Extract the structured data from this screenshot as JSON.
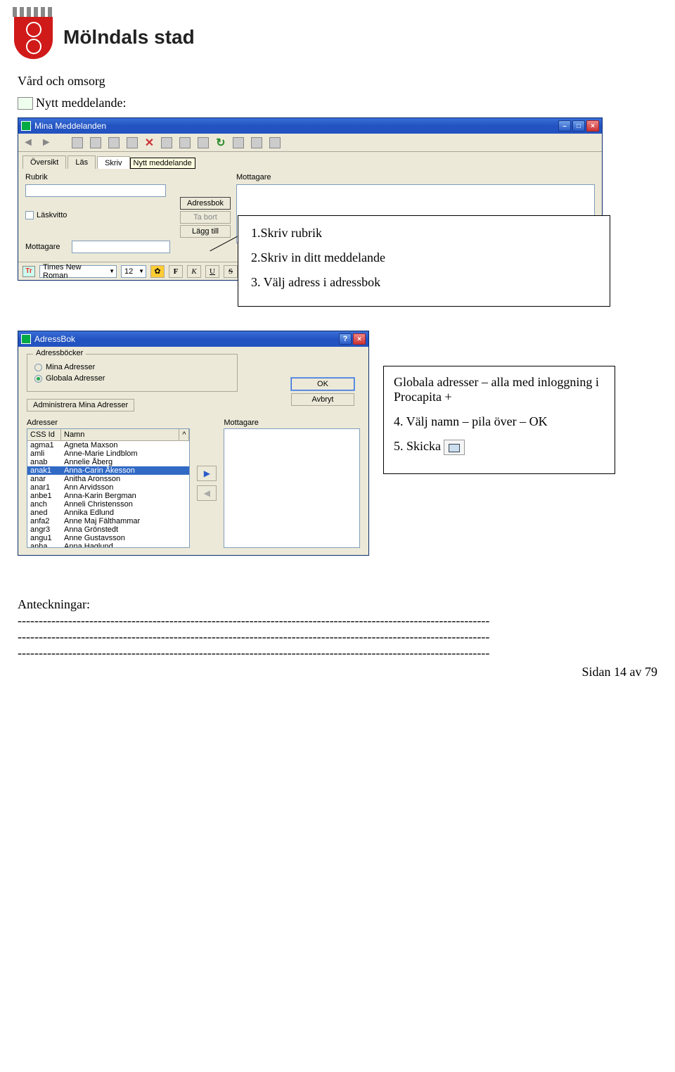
{
  "header": {
    "org": "Mölndals stad"
  },
  "section": {
    "title": "Vård och omsorg",
    "new_msg": "Nytt meddelande:"
  },
  "win_main": {
    "title": "Mina Meddelanden",
    "tabs": {
      "t1": "Översikt",
      "t2": "Läs",
      "t3": "Skriv",
      "tooltip": "Nytt meddelande"
    },
    "labels": {
      "rubrik": "Rubrik",
      "mottagare_top": "Mottagare",
      "laskvitto": "Läskvitto",
      "mottagare": "Mottagare"
    },
    "buttons": {
      "adressbok": "Adressbok",
      "tabort": "Ta bort",
      "laggtill": "Lägg till"
    },
    "format": {
      "font_name": "Times New Roman",
      "font_size": "12",
      "b": "F",
      "i": "K",
      "u": "U",
      "s": "S"
    }
  },
  "callout1": {
    "l1": "1.Skriv rubrik",
    "l2": "2.Skriv in ditt meddelande",
    "l3": "3. Välj adress i adressbok"
  },
  "callout2": {
    "l1": "Globala adresser – alla med inloggning i Procapita +",
    "l2": "4. Välj namn – pila över – OK",
    "l3": "5. Skicka"
  },
  "win_ab": {
    "title": "AdressBok",
    "group": "Adressböcker",
    "radio1": "Mina Adresser",
    "radio2": "Globala Adresser",
    "btn_ok": "OK",
    "btn_cancel": "Avbryt",
    "btn_admin": "Administrera Mina Adresser",
    "lbl_adr": "Adresser",
    "lbl_mot": "Mottagare",
    "hdr_id": "CSS Id",
    "hdr_name": "Namn",
    "rows": [
      {
        "id": "agma1",
        "name": "Agneta Maxson"
      },
      {
        "id": "amli",
        "name": "Anne-Marie Lindblom"
      },
      {
        "id": "anab",
        "name": "Annelie Åberg"
      },
      {
        "id": "anak1",
        "name": "Anna-Carin Åkesson",
        "sel": true
      },
      {
        "id": "anar",
        "name": "Anitha Aronsson"
      },
      {
        "id": "anar1",
        "name": "Ann Arvidsson"
      },
      {
        "id": "anbe1",
        "name": "Anna-Karin Bergman"
      },
      {
        "id": "anch",
        "name": "Anneli Christensson"
      },
      {
        "id": "aned",
        "name": "Annika Edlund"
      },
      {
        "id": "anfa2",
        "name": "Anne Maj Fälthammar"
      },
      {
        "id": "angr3",
        "name": "Anna Grönstedt"
      },
      {
        "id": "angu1",
        "name": "Anne Gustavsson"
      },
      {
        "id": "anha",
        "name": "Anna Haglund"
      }
    ]
  },
  "notes": {
    "title": "Anteckningar:",
    "dash": "----------------------------------------------------------------------------------------------------------------",
    "footer": "Sidan 14 av 79"
  }
}
